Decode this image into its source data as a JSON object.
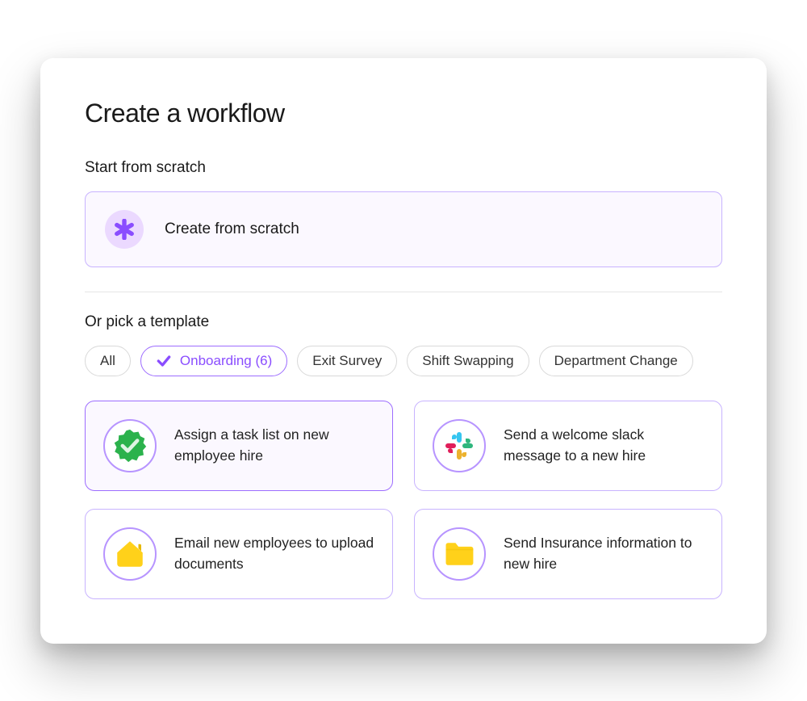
{
  "title": "Create a workflow",
  "scratch_section_label": "Start from scratch",
  "scratch_card_label": "Create from scratch",
  "template_section_label": "Or pick a template",
  "filters": [
    {
      "label": "All",
      "selected": false
    },
    {
      "label": "Onboarding (6)",
      "selected": true
    },
    {
      "label": "Exit Survey",
      "selected": false
    },
    {
      "label": "Shift Swapping",
      "selected": false
    },
    {
      "label": "Department Change",
      "selected": false
    }
  ],
  "templates": [
    {
      "label": "Assign a task list on new employee hire",
      "icon": "checkmark-badge",
      "selected": true
    },
    {
      "label": "Send a welcome slack message to a new hire",
      "icon": "slack",
      "selected": false
    },
    {
      "label": "Email new employees to upload documents",
      "icon": "house",
      "selected": false
    },
    {
      "label": "Send Insurance information to new hire",
      "icon": "folder",
      "selected": false
    }
  ],
  "colors": {
    "accent": "#8a4dff",
    "accent_border": "#c8b3ff",
    "accent_bg": "#fbf8ff",
    "green": "#34c759",
    "yellow": "#ffd11a"
  }
}
